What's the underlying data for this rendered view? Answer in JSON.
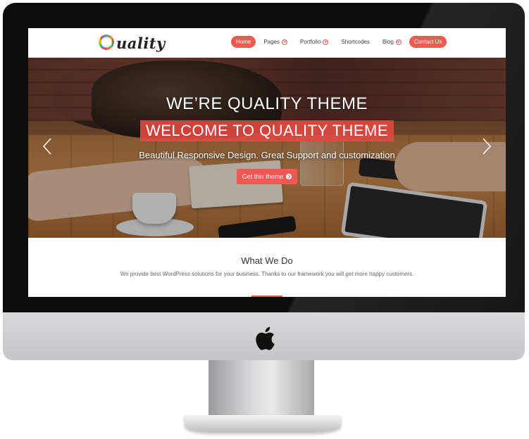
{
  "site": {
    "logo_text": "uality",
    "logo_letter": "Q"
  },
  "nav": {
    "items": [
      {
        "label": "Home",
        "active": true,
        "dropdown": false
      },
      {
        "label": "Pages",
        "active": false,
        "dropdown": true
      },
      {
        "label": "Portfolio",
        "active": false,
        "dropdown": true
      },
      {
        "label": "Shortcodes",
        "active": false,
        "dropdown": false
      },
      {
        "label": "Blog",
        "active": false,
        "dropdown": true
      },
      {
        "label": "Contact Us",
        "active": true,
        "dropdown": false
      }
    ]
  },
  "hero": {
    "line1": "WE’RE QUALITY THEME",
    "line2": "WELCOME TO QUALITY THEME",
    "line3": "Beautiful Responsive Design. Great Support and customization",
    "button_label": "Get this theme"
  },
  "section": {
    "title": "What We Do",
    "text": "We provide best WordPress solutions for your business. Thanks to our framework you will get more happy customers."
  },
  "colors": {
    "accent": "#ee5a52",
    "bezel": "#0c0c0c",
    "chin": "#cfd0d2"
  },
  "icons": {
    "prev": "chevron-left-icon",
    "next": "chevron-right-icon",
    "button": "circle-arrow-right-icon",
    "brand": "apple-logo-icon"
  }
}
